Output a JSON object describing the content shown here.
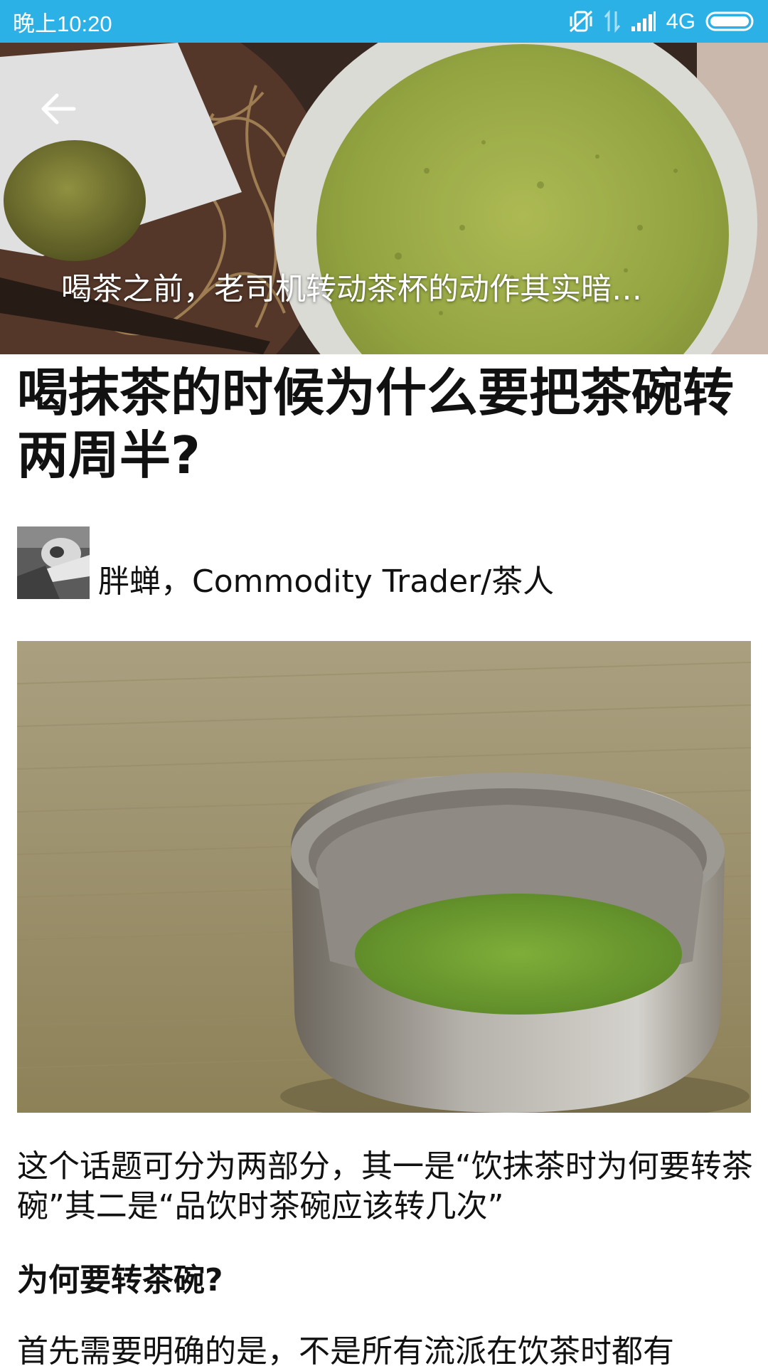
{
  "status_bar": {
    "time": "晚上10:20",
    "network": "4G",
    "icons": [
      "vibrate-off-icon",
      "data-transfer-icon",
      "signal-icon",
      "battery-icon"
    ],
    "background_color": "#2cb1e6"
  },
  "hero": {
    "caption": "喝茶之前，老司机转动茶杯的动作其实暗…",
    "back_icon": "back-arrow-icon"
  },
  "article": {
    "title": "喝抹茶的时候为什么要把茶碗转两周半?",
    "author": "胖蝉，Commodity Trader/茶人",
    "paragraph_1": "这个话题可分为两部分，其一是“饮抹茶时为何要转茶碗”其二是“品饮时茶碗应该转几次”",
    "subheading_1": "为何要转茶碗?",
    "paragraph_2": "首先需要明确的是，不是所有流派在饮茶时都有"
  }
}
